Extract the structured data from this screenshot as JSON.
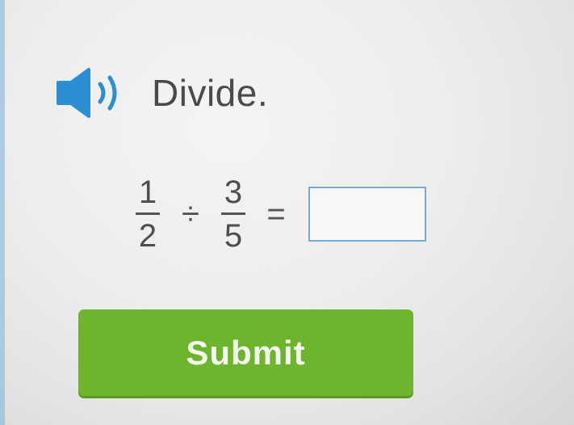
{
  "question": {
    "speaker_icon": "speaker-volume-icon",
    "instruction": "Divide."
  },
  "equation": {
    "fraction1": {
      "numerator": "1",
      "denominator": "2"
    },
    "operator": "÷",
    "fraction2": {
      "numerator": "3",
      "denominator": "5"
    },
    "equals": "=",
    "answer_value": ""
  },
  "submit_label": "Submit",
  "colors": {
    "accent_blue": "#2b8fd6",
    "submit_green": "#6cb52d",
    "answer_border": "#7aa8cf"
  }
}
